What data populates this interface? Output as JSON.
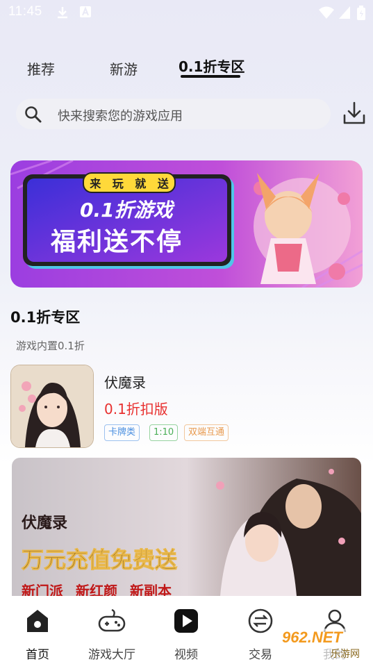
{
  "status": {
    "time": "11:45"
  },
  "tabs": [
    {
      "label": "推荐"
    },
    {
      "label": "新游"
    },
    {
      "label": "0.1折专区",
      "active": true
    }
  ],
  "search": {
    "placeholder": "快来搜索您的游戏应用"
  },
  "banner": {
    "tag_chars": [
      "来",
      "玩",
      "就",
      "送"
    ],
    "line1": "0.1折游戏",
    "line2": "福利送不停"
  },
  "section": {
    "title": "0.1折专区",
    "subtitle": "游戏内置0.1折"
  },
  "game": {
    "name": "伏魔录",
    "discount": "0.1折扣版",
    "tags": [
      "卡牌类",
      "1:10",
      "双端互通"
    ]
  },
  "promo": {
    "logo": "伏魔录",
    "headline": "万元充值免费送",
    "badges": [
      "新门派",
      "新红颜",
      "新副本"
    ]
  },
  "nav": [
    {
      "label": "首页",
      "icon": "home-icon",
      "active": true
    },
    {
      "label": "游戏大厅",
      "icon": "gamepad-icon"
    },
    {
      "label": "视频",
      "icon": "play-icon"
    },
    {
      "label": "交易",
      "icon": "exchange-icon"
    },
    {
      "label": "我的",
      "icon": "user-icon"
    }
  ],
  "watermark": {
    "brand": "962.NET",
    "sub": "乐游网"
  },
  "colors": {
    "discount": "#e8302f",
    "banner_purple": "#b847d9",
    "banner_pink": "#f090c8"
  }
}
